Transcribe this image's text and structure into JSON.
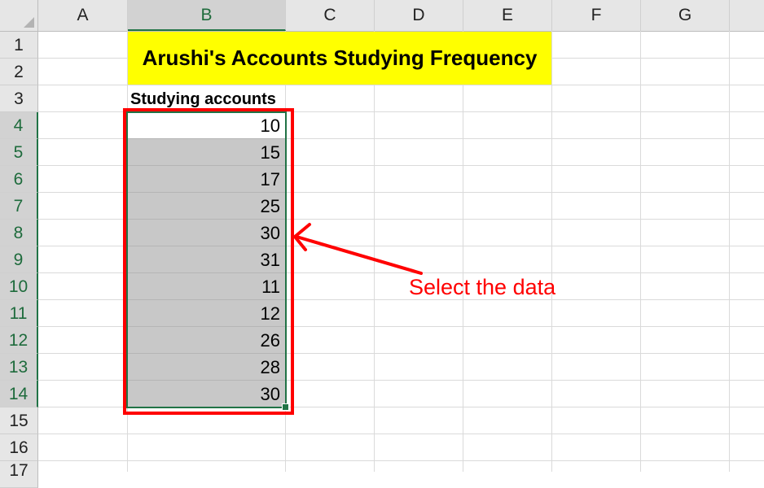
{
  "columns": [
    "A",
    "B",
    "C",
    "D",
    "E",
    "F",
    "G"
  ],
  "selected_column": "B",
  "rows": [
    "1",
    "2",
    "3",
    "4",
    "5",
    "6",
    "7",
    "8",
    "9",
    "10",
    "11",
    "12",
    "13",
    "14",
    "15",
    "16",
    "17"
  ],
  "selected_rows": [
    "4",
    "5",
    "6",
    "7",
    "8",
    "9",
    "10",
    "11",
    "12",
    "13",
    "14"
  ],
  "sheet": {
    "title": "Arushi's Accounts Studying Frequency",
    "column_label": "Studying accounts",
    "values": [
      "10",
      "15",
      "17",
      "25",
      "30",
      "31",
      "11",
      "12",
      "26",
      "28",
      "30"
    ]
  },
  "annotation": {
    "text": "Select the data",
    "color": "#ff0000"
  },
  "colors": {
    "title_fill": "#ffff00",
    "selection_fill": "#c8c8c8",
    "selection_border": "#217346",
    "highlight_box": "#ff0000"
  }
}
